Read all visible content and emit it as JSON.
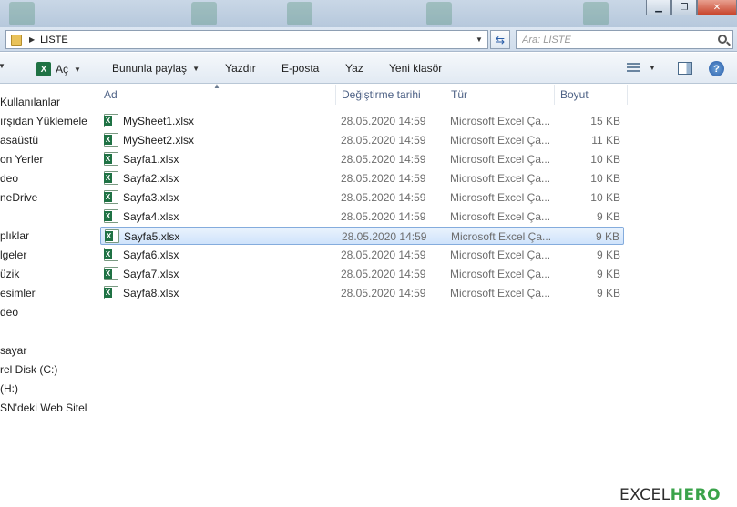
{
  "window": {
    "minimize_label": "▁",
    "maximize_label": "❐",
    "close_label": "✕"
  },
  "address": {
    "path": "LISTE",
    "search_placeholder": "Ara: LISTE"
  },
  "toolbar": {
    "open_label": "Aç",
    "share_label": "Bununla paylaş",
    "print_label": "Yazdır",
    "email_label": "E-posta",
    "burn_label": "Yaz",
    "new_folder_label": "Yeni klasör",
    "help_label": "?"
  },
  "sidebar": {
    "items": [
      "Kullanılanlar",
      "ırşıdan Yüklemeler",
      "asaüstü",
      "on Yerler",
      "deo",
      "neDrive",
      "plıklar",
      "lgeler",
      "üzik",
      "esimler",
      "deo",
      "sayar",
      "rel Disk (C:)",
      "(H:)",
      "SN'deki Web Siteleri"
    ]
  },
  "columns": {
    "name": "Ad",
    "modified": "Değiştirme tarihi",
    "type": "Tür",
    "size": "Boyut"
  },
  "files": [
    {
      "name": "MySheet1.xlsx",
      "modified": "28.05.2020 14:59",
      "type": "Microsoft Excel Ça...",
      "size": "15 KB"
    },
    {
      "name": "MySheet2.xlsx",
      "modified": "28.05.2020 14:59",
      "type": "Microsoft Excel Ça...",
      "size": "11 KB"
    },
    {
      "name": "Sayfa1.xlsx",
      "modified": "28.05.2020 14:59",
      "type": "Microsoft Excel Ça...",
      "size": "10 KB"
    },
    {
      "name": "Sayfa2.xlsx",
      "modified": "28.05.2020 14:59",
      "type": "Microsoft Excel Ça...",
      "size": "10 KB"
    },
    {
      "name": "Sayfa3.xlsx",
      "modified": "28.05.2020 14:59",
      "type": "Microsoft Excel Ça...",
      "size": "10 KB"
    },
    {
      "name": "Sayfa4.xlsx",
      "modified": "28.05.2020 14:59",
      "type": "Microsoft Excel Ça...",
      "size": "9 KB"
    },
    {
      "name": "Sayfa5.xlsx",
      "modified": "28.05.2020 14:59",
      "type": "Microsoft Excel Ça...",
      "size": "9 KB"
    },
    {
      "name": "Sayfa6.xlsx",
      "modified": "28.05.2020 14:59",
      "type": "Microsoft Excel Ça...",
      "size": "9 KB"
    },
    {
      "name": "Sayfa7.xlsx",
      "modified": "28.05.2020 14:59",
      "type": "Microsoft Excel Ça...",
      "size": "9 KB"
    },
    {
      "name": "Sayfa8.xlsx",
      "modified": "28.05.2020 14:59",
      "type": "Microsoft Excel Ça...",
      "size": "9 KB"
    }
  ],
  "selected_file": "Sayfa5.xlsx",
  "watermark": {
    "part1": "EXCEL",
    "part2": "HERO"
  },
  "colors": {
    "selection_fill": "#cfe3fb",
    "selection_border": "#84acdd",
    "column_header_text": "#4d6185",
    "excel_green": "#1f7244"
  }
}
